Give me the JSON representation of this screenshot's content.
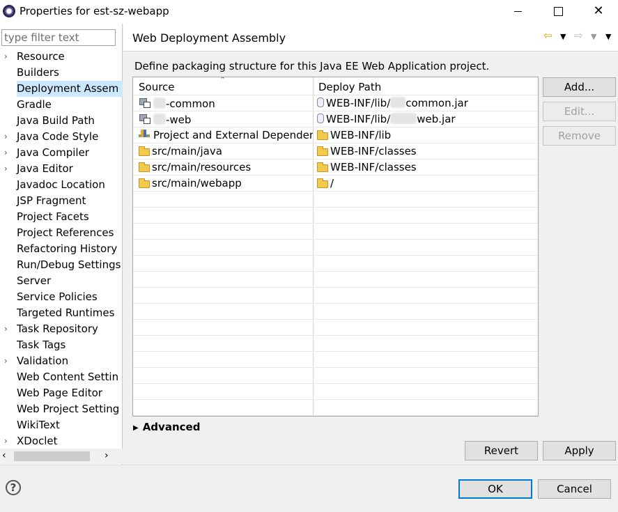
{
  "window": {
    "title": "Properties for est-sz-webapp"
  },
  "filter": {
    "placeholder": "type filter text"
  },
  "nav": {
    "items": [
      {
        "label": "Resource",
        "expandable": true
      },
      {
        "label": "Builders",
        "expandable": false
      },
      {
        "label": "Deployment Assem",
        "expandable": false,
        "selected": true
      },
      {
        "label": "Gradle",
        "expandable": false
      },
      {
        "label": "Java Build Path",
        "expandable": false
      },
      {
        "label": "Java Code Style",
        "expandable": true
      },
      {
        "label": "Java Compiler",
        "expandable": true
      },
      {
        "label": "Java Editor",
        "expandable": true
      },
      {
        "label": "Javadoc Location",
        "expandable": false
      },
      {
        "label": "JSP Fragment",
        "expandable": false
      },
      {
        "label": "Project Facets",
        "expandable": false
      },
      {
        "label": "Project References",
        "expandable": false
      },
      {
        "label": "Refactoring History",
        "expandable": false
      },
      {
        "label": "Run/Debug Settings",
        "expandable": false
      },
      {
        "label": "Server",
        "expandable": false
      },
      {
        "label": "Service Policies",
        "expandable": false
      },
      {
        "label": "Targeted Runtimes",
        "expandable": false
      },
      {
        "label": "Task Repository",
        "expandable": true
      },
      {
        "label": "Task Tags",
        "expandable": false
      },
      {
        "label": "Validation",
        "expandable": true
      },
      {
        "label": "Web Content Settin",
        "expandable": false
      },
      {
        "label": "Web Page Editor",
        "expandable": false
      },
      {
        "label": "Web Project Setting",
        "expandable": false
      },
      {
        "label": "WikiText",
        "expandable": false
      },
      {
        "label": "XDoclet",
        "expandable": true
      }
    ]
  },
  "page": {
    "title": "Web Deployment Assembly",
    "description": "Define packaging structure for this Java EE Web Application project."
  },
  "table": {
    "headers": {
      "source": "Source",
      "deploy": "Deploy Path"
    },
    "rows": [
      {
        "source": "-common",
        "deploy_prefix": "WEB-INF/lib/",
        "deploy_suffix": "common.jar",
        "icon": "project-icon",
        "deploy_icon": "jar-icon",
        "redacted": true
      },
      {
        "source": "-web",
        "deploy_prefix": "WEB-INF/lib/",
        "deploy_suffix": "web.jar",
        "icon": "project-icon",
        "deploy_icon": "jar-icon",
        "redacted": true
      },
      {
        "source": "Project and External Dependencies",
        "deploy": "WEB-INF/lib",
        "icon": "library-icon",
        "deploy_icon": "folder-icon"
      },
      {
        "source": "src/main/java",
        "deploy": "WEB-INF/classes",
        "icon": "folder-icon",
        "deploy_icon": "folder-icon"
      },
      {
        "source": "src/main/resources",
        "deploy": "WEB-INF/classes",
        "icon": "folder-icon",
        "deploy_icon": "folder-icon"
      },
      {
        "source": "src/main/webapp",
        "deploy": "/",
        "icon": "folder-icon",
        "deploy_icon": "folder-icon"
      }
    ]
  },
  "advanced": {
    "label": "Advanced"
  },
  "buttons": {
    "add": "Add...",
    "edit": "Edit...",
    "remove": "Remove",
    "revert": "Revert",
    "apply": "Apply",
    "ok": "OK",
    "cancel": "Cancel"
  },
  "colors": {
    "selection": "#cce8ff",
    "ok_border": "#0078d7"
  }
}
